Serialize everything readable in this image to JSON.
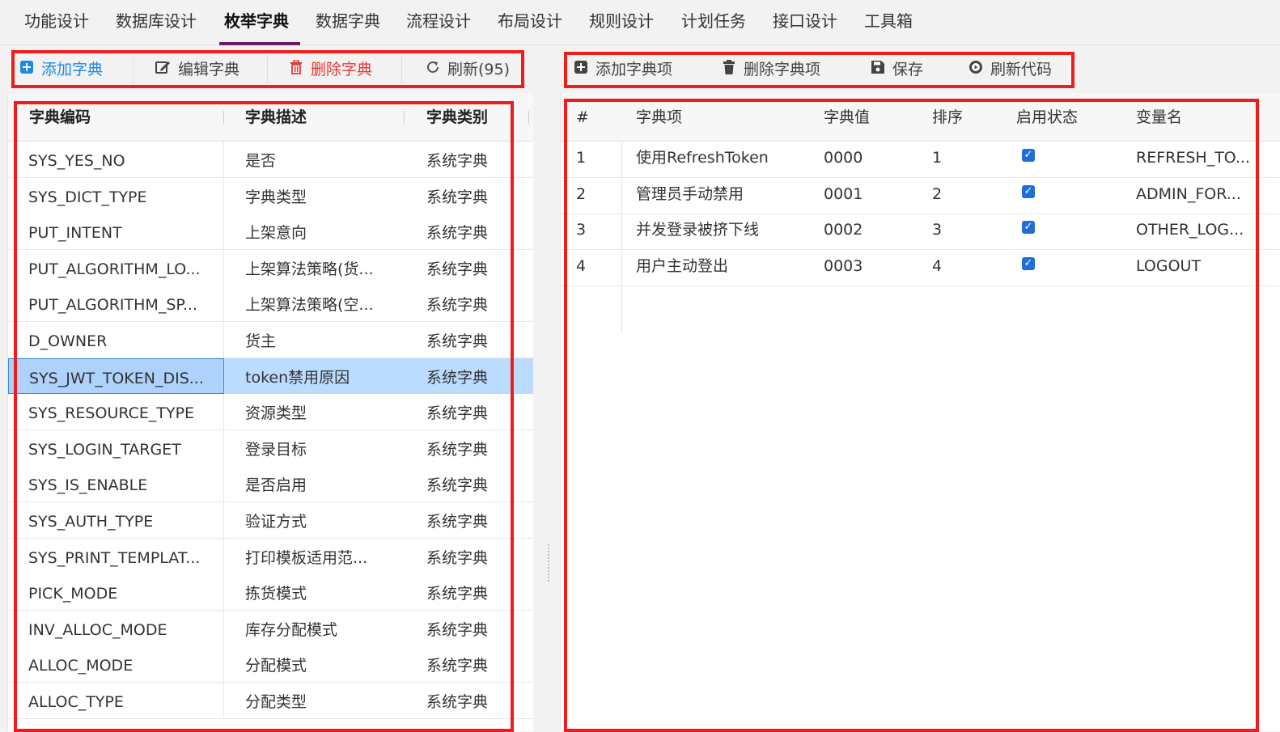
{
  "top_tabs": [
    {
      "label": "功能设计",
      "active": false
    },
    {
      "label": "数据库设计",
      "active": false
    },
    {
      "label": "枚举字典",
      "active": true
    },
    {
      "label": "数据字典",
      "active": false
    },
    {
      "label": "流程设计",
      "active": false
    },
    {
      "label": "布局设计",
      "active": false
    },
    {
      "label": "规则设计",
      "active": false
    },
    {
      "label": "计划任务",
      "active": false
    },
    {
      "label": "接口设计",
      "active": false
    },
    {
      "label": "工具箱",
      "active": false
    }
  ],
  "left_toolbar": {
    "add": {
      "label": "添加字典",
      "icon": "plus-square-icon",
      "color": "#1e88e5"
    },
    "edit": {
      "label": "编辑字典",
      "icon": "edit-icon",
      "color": "#444444"
    },
    "delete": {
      "label": "删除字典",
      "icon": "trash-icon",
      "color": "#e53935"
    },
    "refresh": {
      "label": "刷新(95)",
      "icon": "refresh-icon",
      "color": "#444444"
    }
  },
  "right_toolbar": {
    "add_item": {
      "label": "添加字典项",
      "icon": "plus-square-icon"
    },
    "delete_item": {
      "label": "删除字典项",
      "icon": "trash-icon"
    },
    "save": {
      "label": "保存",
      "icon": "save-icon"
    },
    "refresh_code": {
      "label": "刷新代码",
      "icon": "play-circle-icon"
    }
  },
  "left_table": {
    "headers": [
      "字典编码",
      "字典描述",
      "字典类别"
    ],
    "rows": [
      {
        "code": "SYS_YES_NO",
        "desc": "是否",
        "type": "系统字典"
      },
      {
        "code": "SYS_DICT_TYPE",
        "desc": "字典类型",
        "type": "系统字典"
      },
      {
        "code": "PUT_INTENT",
        "desc": "上架意向",
        "type": "系统字典"
      },
      {
        "code": "PUT_ALGORITHM_LO...",
        "desc": "上架算法策略(货...",
        "type": "系统字典"
      },
      {
        "code": "PUT_ALGORITHM_SP...",
        "desc": "上架算法策略(空...",
        "type": "系统字典"
      },
      {
        "code": "D_OWNER",
        "desc": "货主",
        "type": "系统字典"
      },
      {
        "code": "SYS_JWT_TOKEN_DIS...",
        "desc": "token禁用原因",
        "type": "系统字典",
        "selected": true
      },
      {
        "code": "SYS_RESOURCE_TYPE",
        "desc": "资源类型",
        "type": "系统字典"
      },
      {
        "code": "SYS_LOGIN_TARGET",
        "desc": "登录目标",
        "type": "系统字典"
      },
      {
        "code": "SYS_IS_ENABLE",
        "desc": "是否启用",
        "type": "系统字典"
      },
      {
        "code": "SYS_AUTH_TYPE",
        "desc": "验证方式",
        "type": "系统字典"
      },
      {
        "code": "SYS_PRINT_TEMPLAT...",
        "desc": "打印模板适用范...",
        "type": "系统字典"
      },
      {
        "code": "PICK_MODE",
        "desc": "拣货模式",
        "type": "系统字典"
      },
      {
        "code": "INV_ALLOC_MODE",
        "desc": "库存分配模式",
        "type": "系统字典"
      },
      {
        "code": "ALLOC_MODE",
        "desc": "分配模式",
        "type": "系统字典"
      },
      {
        "code": "ALLOC_TYPE",
        "desc": "分配类型",
        "type": "系统字典"
      }
    ]
  },
  "right_table": {
    "headers": [
      "#",
      "字典项",
      "字典值",
      "排序",
      "启用状态",
      "变量名"
    ],
    "rows": [
      {
        "num": "1",
        "item": "使用RefreshToken",
        "value": "0000",
        "order": "1",
        "enabled": true,
        "var": "REFRESH_TO..."
      },
      {
        "num": "2",
        "item": "管理员手动禁用",
        "value": "0001",
        "order": "2",
        "enabled": true,
        "var": "ADMIN_FOR..."
      },
      {
        "num": "3",
        "item": "并发登录被挤下线",
        "value": "0002",
        "order": "3",
        "enabled": true,
        "var": "OTHER_LOG..."
      },
      {
        "num": "4",
        "item": "用户主动登出",
        "value": "0003",
        "order": "4",
        "enabled": true,
        "var": "LOGOUT"
      }
    ]
  },
  "colors": {
    "highlight_box": "#ef1c1c",
    "active_tab_underline": "#6a1b6a",
    "selected_row": "#bcdcff",
    "checkbox": "#1e6fd9"
  }
}
